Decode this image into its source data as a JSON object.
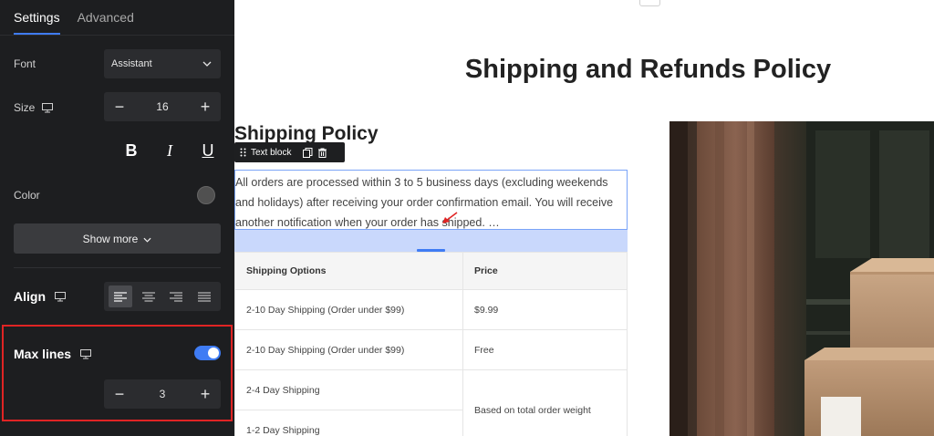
{
  "panel": {
    "tabs": [
      {
        "label": "Settings",
        "active": true
      },
      {
        "label": "Advanced",
        "active": false
      }
    ],
    "font": {
      "label": "Font",
      "value": "Assistant",
      "icon": "chevron-down-icon"
    },
    "size": {
      "label": "Size",
      "value": "16",
      "device_icon": "desktop-icon"
    },
    "text_styles": [
      "B",
      "I",
      "U"
    ],
    "color": {
      "label": "Color",
      "value": "#505050"
    },
    "show_more": "Show more",
    "align": {
      "label": "Align",
      "options": [
        "left",
        "center",
        "right",
        "justify"
      ],
      "selected": "left"
    },
    "max_lines": {
      "label": "Max lines",
      "enabled": true,
      "value": "3"
    }
  },
  "canvas": {
    "page_title": "Shipping and Refunds Policy",
    "section_heading": "Shipping Policy",
    "toolbar_label": "Text block",
    "text_block": "All orders are processed within 3 to 5 business days (excluding weekends and holidays) after receiving your order confirmation email. You will receive another notification when your order has shipped. …",
    "table": {
      "headers": [
        "Shipping Options",
        "Price"
      ],
      "rows": [
        [
          "2-10 Day Shipping (Order under $99)",
          "$9.99"
        ],
        [
          "2-10 Day Shipping (Order under $99)",
          "Free"
        ],
        [
          "2-4 Day Shipping",
          "Based on total order weight"
        ],
        [
          "1-2 Day Shipping",
          ""
        ]
      ]
    }
  },
  "colors": {
    "accent": "#3f7cf4",
    "panel_bg": "#1d1e20",
    "highlight": "#e02424"
  }
}
